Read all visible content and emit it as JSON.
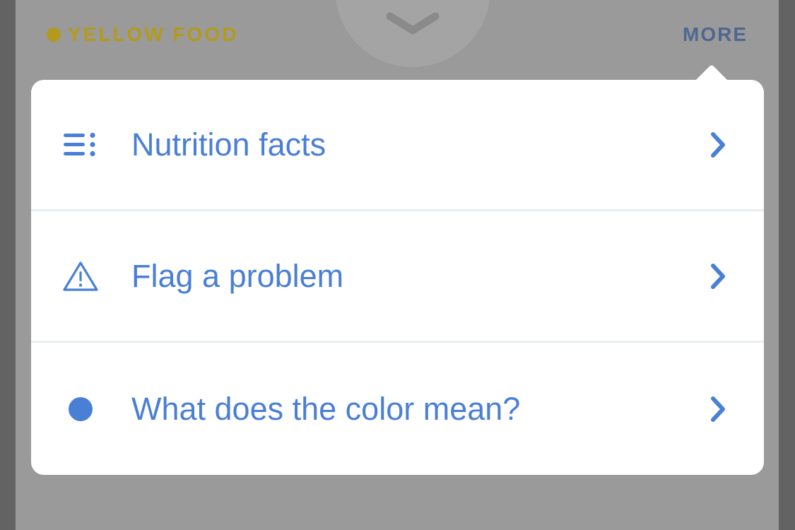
{
  "header": {
    "food_tag_label": "YELLOW FOOD",
    "more_label": "MORE"
  },
  "menu": {
    "items": [
      {
        "label": "Nutrition facts",
        "icon": "list-icon"
      },
      {
        "label": "Flag a problem",
        "icon": "warning-icon"
      },
      {
        "label": "What does the color mean?",
        "icon": "dot-icon"
      }
    ]
  },
  "colors": {
    "accent_blue": "#4a7fd6",
    "food_yellow": "#b39a1c",
    "more_blue": "#4f6791",
    "overlay_gray": "#9a9a9a"
  }
}
